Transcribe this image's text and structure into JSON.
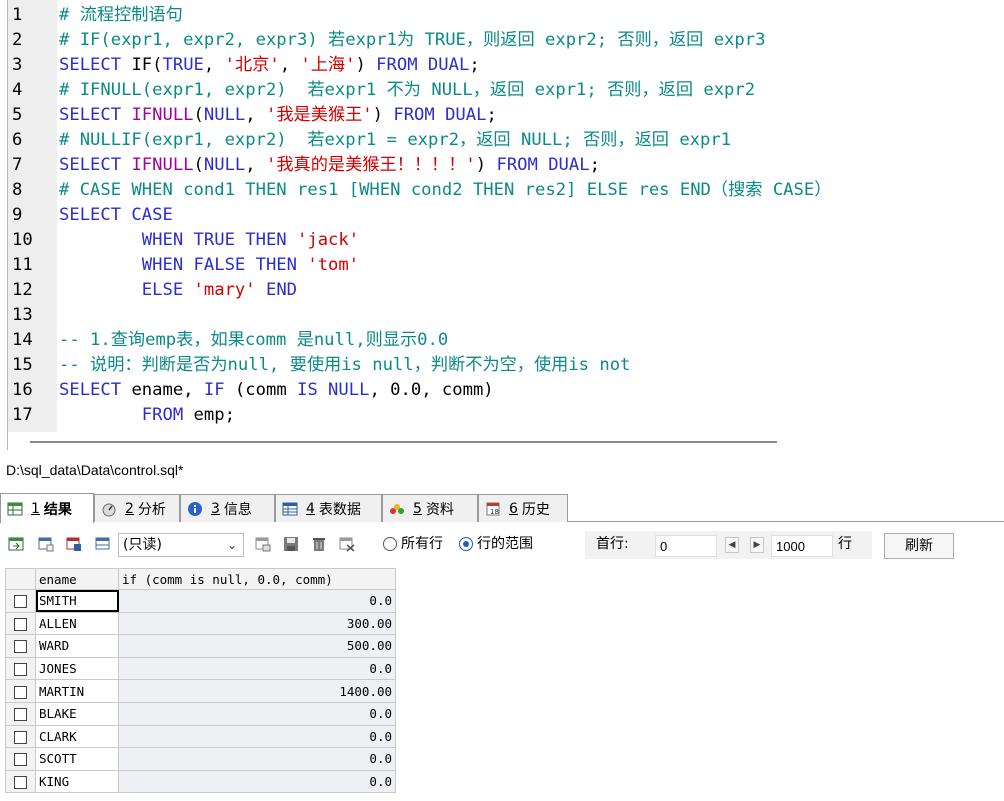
{
  "editor": {
    "lines": [
      {
        "no": "1",
        "tokens": [
          {
            "t": "# 流程控制语句",
            "c": "cmt"
          }
        ]
      },
      {
        "no": "2",
        "tokens": [
          {
            "t": "# IF(expr1, expr2, expr3) 若expr1为 TRUE，则返回 expr2; 否则，返回 expr3",
            "c": "cmt"
          }
        ]
      },
      {
        "no": "3",
        "tokens": [
          {
            "t": "SELECT ",
            "c": "kw"
          },
          {
            "t": "IF",
            "c": "plain"
          },
          {
            "t": "(",
            "c": "plain"
          },
          {
            "t": "TRUE",
            "c": "kw"
          },
          {
            "t": ", ",
            "c": "plain"
          },
          {
            "t": "'北京'",
            "c": "str"
          },
          {
            "t": ", ",
            "c": "plain"
          },
          {
            "t": "'上海'",
            "c": "str"
          },
          {
            "t": ") ",
            "c": "plain"
          },
          {
            "t": "FROM DUAL",
            "c": "kw"
          },
          {
            "t": ";",
            "c": "plain"
          }
        ]
      },
      {
        "no": "4",
        "tokens": [
          {
            "t": "# IFNULL(expr1, expr2)  若expr1 不为 NULL，返回 expr1; 否则，返回 expr2",
            "c": "cmt"
          }
        ]
      },
      {
        "no": "5",
        "tokens": [
          {
            "t": "SELECT ",
            "c": "kw"
          },
          {
            "t": "IFNULL",
            "c": "fn"
          },
          {
            "t": "(",
            "c": "plain"
          },
          {
            "t": "NULL",
            "c": "kw"
          },
          {
            "t": ", ",
            "c": "plain"
          },
          {
            "t": "'我是美猴王'",
            "c": "str"
          },
          {
            "t": ") ",
            "c": "plain"
          },
          {
            "t": "FROM DUAL",
            "c": "kw"
          },
          {
            "t": ";",
            "c": "plain"
          }
        ]
      },
      {
        "no": "6",
        "tokens": [
          {
            "t": "# NULLIF(expr1, expr2)  若expr1 = expr2，返回 NULL; 否则，返回 expr1",
            "c": "cmt"
          }
        ]
      },
      {
        "no": "7",
        "tokens": [
          {
            "t": "SELECT ",
            "c": "kw"
          },
          {
            "t": "IFNULL",
            "c": "fn"
          },
          {
            "t": "(",
            "c": "plain"
          },
          {
            "t": "NULL",
            "c": "kw"
          },
          {
            "t": ", ",
            "c": "plain"
          },
          {
            "t": "'我真的是美猴王！！！！'",
            "c": "str"
          },
          {
            "t": ") ",
            "c": "plain"
          },
          {
            "t": "FROM DUAL",
            "c": "kw"
          },
          {
            "t": ";",
            "c": "plain"
          }
        ]
      },
      {
        "no": "8",
        "tokens": [
          {
            "t": "# CASE WHEN cond1 THEN res1 [WHEN cond2 THEN res2] ELSE res END（搜索 CASE）",
            "c": "cmt"
          }
        ]
      },
      {
        "no": "9",
        "tokens": [
          {
            "t": "SELECT CASE",
            "c": "kw"
          }
        ]
      },
      {
        "no": "10",
        "tokens": [
          {
            "t": "        WHEN TRUE THEN ",
            "c": "kw"
          },
          {
            "t": "'jack'",
            "c": "str"
          }
        ]
      },
      {
        "no": "11",
        "tokens": [
          {
            "t": "        WHEN FALSE THEN ",
            "c": "kw"
          },
          {
            "t": "'tom'",
            "c": "str"
          }
        ]
      },
      {
        "no": "12",
        "tokens": [
          {
            "t": "        ELSE ",
            "c": "kw"
          },
          {
            "t": "'mary'",
            "c": "str"
          },
          {
            "t": " END",
            "c": "kw"
          }
        ]
      },
      {
        "no": "13",
        "tokens": []
      },
      {
        "no": "14",
        "tokens": [
          {
            "t": "-- 1.查询emp表，如果comm 是null,则显示0.0",
            "c": "cmt"
          }
        ]
      },
      {
        "no": "15",
        "tokens": [
          {
            "t": "-- 说明：判断是否为null, 要使用is null，判断不为空，使用is not",
            "c": "cmt"
          }
        ]
      },
      {
        "no": "16",
        "tokens": [
          {
            "t": "SELECT ",
            "c": "kw"
          },
          {
            "t": "ename, ",
            "c": "plain"
          },
          {
            "t": "IF ",
            "c": "kw"
          },
          {
            "t": "(comm ",
            "c": "plain"
          },
          {
            "t": "IS NULL",
            "c": "kw"
          },
          {
            "t": ", ",
            "c": "plain"
          },
          {
            "t": "0.0",
            "c": "num"
          },
          {
            "t": ", comm)",
            "c": "plain"
          }
        ]
      },
      {
        "no": "17",
        "tokens": [
          {
            "t": "        FROM ",
            "c": "kw"
          },
          {
            "t": "emp;",
            "c": "plain"
          }
        ]
      }
    ]
  },
  "file_path": "D:\\sql_data\\Data\\control.sql*",
  "tabs": [
    {
      "key": "1",
      "label": "结果",
      "icon": "result-grid-icon",
      "active": true
    },
    {
      "key": "2",
      "label": "分析",
      "icon": "profiler-icon",
      "active": false
    },
    {
      "key": "3",
      "label": "信息",
      "icon": "info-icon",
      "active": false
    },
    {
      "key": "4",
      "label": "表数据",
      "icon": "table-data-icon",
      "active": false
    },
    {
      "key": "5",
      "label": "资料",
      "icon": "data-info-icon",
      "active": false
    },
    {
      "key": "6",
      "label": "历史",
      "icon": "history-icon",
      "active": false
    }
  ],
  "toolbar": {
    "mode": "(只读)",
    "radio_all_rows": "所有行",
    "radio_row_range": "行的范围",
    "start_row_label": "首行:",
    "start_row_value": "0",
    "row_count_value": "1000",
    "row_unit": "行",
    "refresh_label": "刷新"
  },
  "grid": {
    "columns": [
      "ename",
      "if (comm is null, 0.0, comm)"
    ],
    "rows": [
      [
        "SMITH",
        "0.0"
      ],
      [
        "ALLEN",
        "300.00"
      ],
      [
        "WARD",
        "500.00"
      ],
      [
        "JONES",
        "0.0"
      ],
      [
        "MARTIN",
        "1400.00"
      ],
      [
        "BLAKE",
        "0.0"
      ],
      [
        "CLARK",
        "0.0"
      ],
      [
        "SCOTT",
        "0.0"
      ],
      [
        "KING",
        "0.0"
      ]
    ]
  },
  "colors": {
    "keyword": "#2d2dcf",
    "function": "#a000a0",
    "string": "#d40000",
    "comment": "#0b8b88"
  }
}
